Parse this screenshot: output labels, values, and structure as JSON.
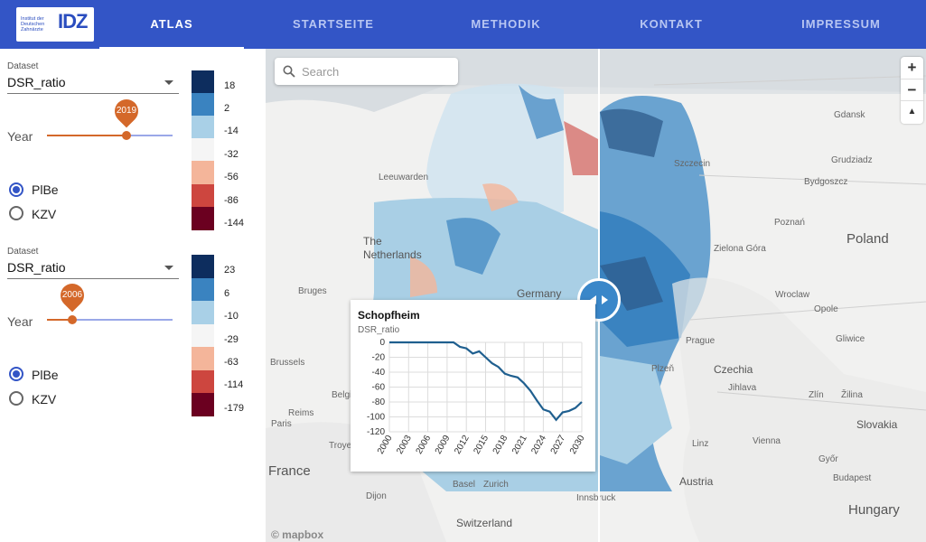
{
  "header": {
    "logo_small": "Institut der Deutschen Zahnärzte",
    "logo_big": "IDZ",
    "tabs": [
      {
        "label": "ATLAS",
        "active": true
      },
      {
        "label": "STARTSEITE",
        "active": false
      },
      {
        "label": "METHODIK",
        "active": false
      },
      {
        "label": "KONTAKT",
        "active": false
      },
      {
        "label": "IMPRESSUM",
        "active": false
      }
    ],
    "bg_color": "#3355c6"
  },
  "panel_left": {
    "dataset_label": "Dataset",
    "dataset_value": "DSR_ratio",
    "year_label": "Year",
    "year_value": "2019",
    "year_fraction": 0.73,
    "radio_options": [
      "PlBe",
      "KZV"
    ],
    "radio_selected": "PlBe",
    "legend_values": [
      "18",
      "2",
      "-14",
      "-32",
      "-56",
      "-86",
      "-144"
    ]
  },
  "panel_right": {
    "dataset_label": "Dataset",
    "dataset_value": "DSR_ratio",
    "year_label": "Year",
    "year_value": "2006",
    "year_fraction": 0.2,
    "radio_options": [
      "PlBe",
      "KZV"
    ],
    "radio_selected": "PlBe",
    "legend_values": [
      "23",
      "6",
      "-10",
      "-29",
      "-63",
      "-114",
      "-179"
    ]
  },
  "legend_colors": [
    "#0d2d5e",
    "#3a83c0",
    "#a9d0e7",
    "#f5f5f5",
    "#f4b59a",
    "#cd463f",
    "#6b0020"
  ],
  "map": {
    "search_placeholder": "Search",
    "zoom_in": "+",
    "zoom_out": "−",
    "compass": "▲",
    "attribution": "© mapbox",
    "places": [
      {
        "name": "Gdansk",
        "cls": ""
      },
      {
        "name": "Grudziadz",
        "cls": ""
      },
      {
        "name": "Bydgoszcz",
        "cls": ""
      },
      {
        "name": "Szczecin",
        "cls": ""
      },
      {
        "name": "Poznań",
        "cls": ""
      },
      {
        "name": "Poland",
        "cls": "big"
      },
      {
        "name": "Zielona Góra",
        "cls": ""
      },
      {
        "name": "Wroclaw",
        "cls": ""
      },
      {
        "name": "Opole",
        "cls": ""
      },
      {
        "name": "Gliwice",
        "cls": ""
      },
      {
        "name": "Prague",
        "cls": ""
      },
      {
        "name": "Plzeň",
        "cls": ""
      },
      {
        "name": "Czechia",
        "cls": "mid"
      },
      {
        "name": "Jihlava",
        "cls": ""
      },
      {
        "name": "Zlín",
        "cls": ""
      },
      {
        "name": "Žilina",
        "cls": ""
      },
      {
        "name": "Slovakia",
        "cls": "mid"
      },
      {
        "name": "Vienna",
        "cls": ""
      },
      {
        "name": "Linz",
        "cls": ""
      },
      {
        "name": "Győr",
        "cls": ""
      },
      {
        "name": "Budapest",
        "cls": ""
      },
      {
        "name": "Austria",
        "cls": "mid"
      },
      {
        "name": "Hungary",
        "cls": "big"
      },
      {
        "name": "Innsbruck",
        "cls": ""
      },
      {
        "name": "Leeuwarden",
        "cls": ""
      },
      {
        "name": "The Netherlands",
        "cls": "mid"
      },
      {
        "name": "Bruges",
        "cls": ""
      },
      {
        "name": "Brussels",
        "cls": ""
      },
      {
        "name": "Belgium",
        "cls": ""
      },
      {
        "name": "Reims",
        "cls": ""
      },
      {
        "name": "Paris",
        "cls": ""
      },
      {
        "name": "Troyes",
        "cls": ""
      },
      {
        "name": "France",
        "cls": "big"
      },
      {
        "name": "Dijon",
        "cls": ""
      },
      {
        "name": "Basel",
        "cls": ""
      },
      {
        "name": "Zurich",
        "cls": ""
      },
      {
        "name": "Switzerland",
        "cls": "mid"
      },
      {
        "name": "Germany",
        "cls": "mid"
      }
    ]
  },
  "popup": {
    "title": "Schopfheim",
    "ylabel": "DSR_ratio"
  },
  "chart_data": {
    "type": "line",
    "title": "Schopfheim",
    "xlabel": "",
    "ylabel": "DSR_ratio",
    "ylim": [
      -120,
      0
    ],
    "xlim": [
      2000,
      2030
    ],
    "yticks": [
      0,
      -20,
      -40,
      -60,
      -80,
      -100,
      -120
    ],
    "xticks": [
      2000,
      2003,
      2006,
      2009,
      2012,
      2015,
      2018,
      2021,
      2024,
      2027,
      2030
    ],
    "grid": true,
    "series": [
      {
        "x": [
          2000,
          2003,
          2006,
          2009,
          2010,
          2011,
          2012,
          2013,
          2014,
          2015,
          2016,
          2017,
          2018,
          2019,
          2020,
          2021,
          2022,
          2023,
          2024,
          2025,
          2026,
          2027,
          2028,
          2029,
          2030
        ],
        "values": [
          0,
          0,
          0,
          0,
          0,
          -6,
          -8,
          -15,
          -12,
          -20,
          -28,
          -33,
          -42,
          -45,
          -47,
          -55,
          -65,
          -78,
          -90,
          -93,
          -104,
          -94,
          -92,
          -88,
          -80
        ]
      }
    ]
  }
}
